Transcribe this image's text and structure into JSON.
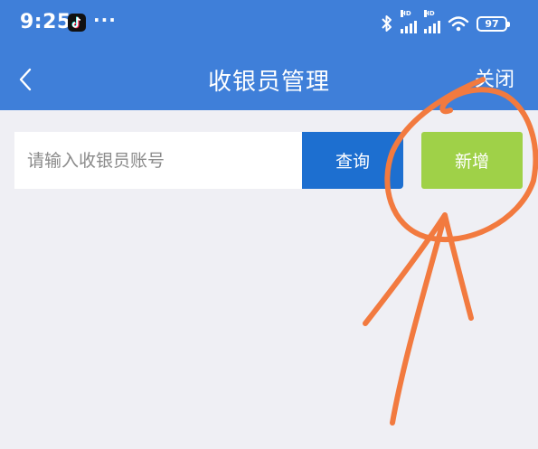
{
  "status_bar": {
    "time": "9:25",
    "app_icon": "tiktok-icon",
    "more": "···",
    "signal_label": "HD",
    "battery": "97"
  },
  "header": {
    "back_icon": "chevron-left-icon",
    "title": "收银员管理",
    "close_label": "关闭",
    "background": "#3f7fd9"
  },
  "search": {
    "placeholder": "请输入收银员账号",
    "value": ""
  },
  "buttons": {
    "query_label": "查询",
    "add_label": "新增",
    "query_color": "#1d6fd0",
    "add_color": "#9fd148"
  },
  "annotation": {
    "color": "#f27a3f",
    "description_icon": "hand-drawn-circle-arrow"
  }
}
